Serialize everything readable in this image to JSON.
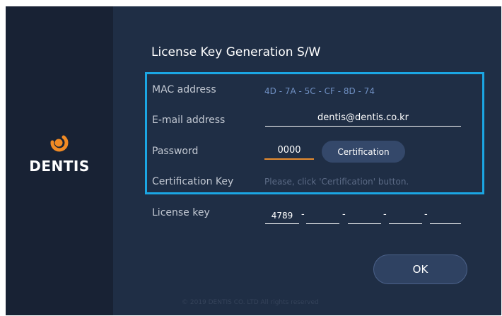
{
  "brand": {
    "logo_text": "DENTIS",
    "logo_color": "#f08a24"
  },
  "form": {
    "title": "License Key Generation S/W",
    "mac_label": "MAC address",
    "mac_value": "4D - 7A - 5C - CF - 8D - 74",
    "email_label": "E-mail address",
    "email_value": "dentis@dentis.co.kr",
    "password_label": "Password",
    "password_value": "0000",
    "certification_button": "Certification",
    "cert_key_label": "Certification Key",
    "cert_key_hint": "Please, click 'Certification' button.",
    "license_label": "License key",
    "license_parts": [
      "4789",
      "",
      "",
      "",
      ""
    ],
    "license_separator": "-"
  },
  "ok_button": "OK",
  "footer": "© 2019 DENTIS CO. LTD All  rights reserved",
  "colors": {
    "highlight_border": "#1ba6e3",
    "password_underline": "#e88d2e",
    "background": "#1f2e45"
  }
}
